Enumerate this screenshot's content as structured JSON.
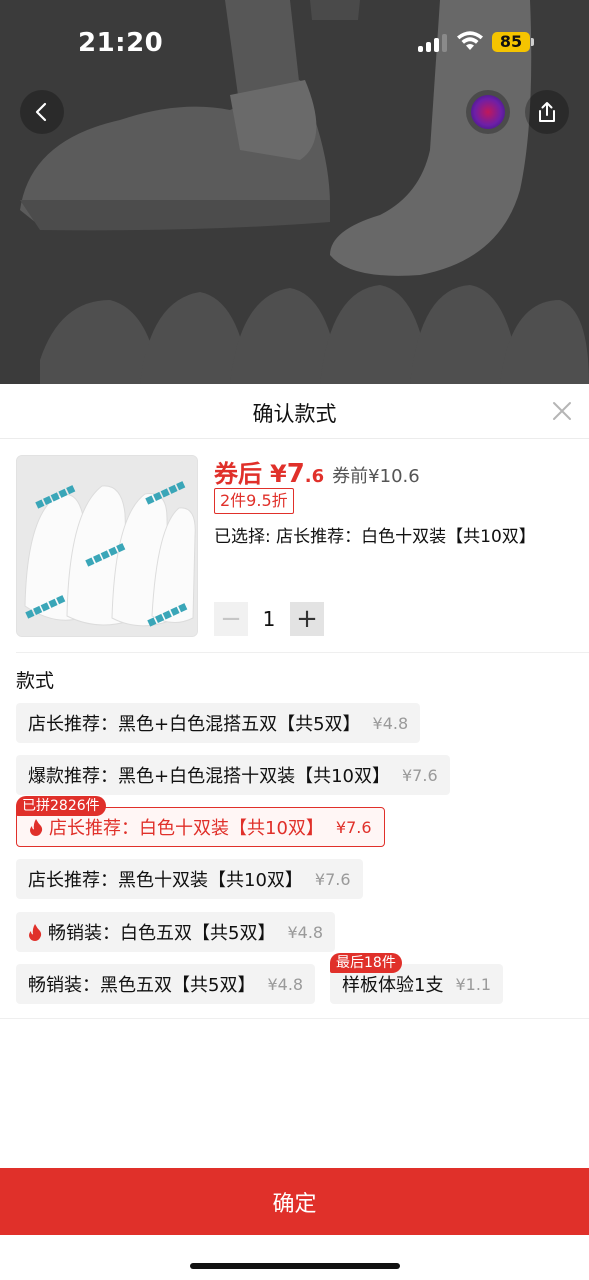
{
  "status_bar": {
    "time": "21:20",
    "battery": "85"
  },
  "nav": {
    "back_icon": "chevron-left-icon",
    "share_icon": "share-icon"
  },
  "sheet": {
    "title": "确认款式"
  },
  "product": {
    "price_label": "券后",
    "currency": "¥",
    "price_int": "7",
    "price_dec": ".6",
    "pre_price": "券前¥10.6",
    "discount_tag": "2件9.5折",
    "selected_text": "已选择: 店长推荐：白色十双装【共10双】",
    "quantity": "1",
    "minus": "−",
    "plus": "+"
  },
  "section_title": "款式",
  "options": [
    {
      "label": "店长推荐：黑色+白色混搭五双【共5双】",
      "price": "¥4.8"
    },
    {
      "label": "爆款推荐：黑色+白色混搭十双装【共10双】",
      "price": "¥7.6"
    },
    {
      "label": "店长推荐：白色十双装【共10双】",
      "price": "¥7.6",
      "badge": "已拼2826件",
      "selected": true,
      "hot": true
    },
    {
      "label": "店长推荐：黑色十双装【共10双】",
      "price": "¥7.6"
    },
    {
      "label": "畅销装：白色五双【共5双】",
      "price": "¥4.8",
      "hot": true
    },
    {
      "label": "畅销装：黑色五双【共5双】",
      "price": "¥4.8"
    },
    {
      "label": "样板体验1支",
      "price": "¥1.1",
      "badge": "最后18件"
    }
  ],
  "confirm_label": "确定",
  "colors": {
    "accent": "#e0302a",
    "option_bg": "#f3f3f3"
  }
}
